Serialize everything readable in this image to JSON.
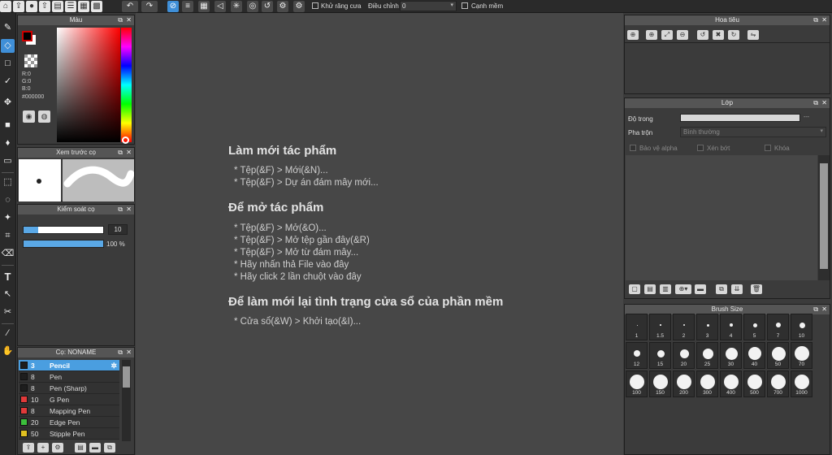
{
  "toolbar": {
    "antialias_label": "Khử răng cưa",
    "adjust_label": "Điều chỉnh",
    "adjust_value": "0",
    "soft_edge_label": "Cạnh mềm"
  },
  "color_panel": {
    "title": "Màu",
    "r": "R:0",
    "g": "G:0",
    "b": "B:0",
    "hex": "#000000",
    "main_color": "#000000",
    "accent": "#cc0000"
  },
  "preview_panel": {
    "title": "Xem trước cọ"
  },
  "brush_control": {
    "title": "Kiểm soát cọ",
    "size_value": "10",
    "opacity_value": "100 %"
  },
  "brush_panel": {
    "title": "Cọ: NONAME",
    "brushes": [
      {
        "size": "3",
        "name": "Pencil",
        "color": "#1e1e1e"
      },
      {
        "size": "8",
        "name": "Pen",
        "color": "#1e1e1e"
      },
      {
        "size": "8",
        "name": "Pen (Sharp)",
        "color": "#1e1e1e"
      },
      {
        "size": "10",
        "name": "G Pen",
        "color": "#e03a3a"
      },
      {
        "size": "8",
        "name": "Mapping Pen",
        "color": "#e03a3a"
      },
      {
        "size": "20",
        "name": "Edge Pen",
        "color": "#3cc03c"
      },
      {
        "size": "50",
        "name": "Stipple Pen",
        "color": "#e0c020"
      }
    ]
  },
  "canvas": {
    "new_heading": "Làm mới tác phẩm",
    "new_items": [
      "* Tệp(&F) > Mới(&N)...",
      "* Tệp(&F) > Dự án đám mây mới..."
    ],
    "open_heading": "Để mở tác phẩm",
    "open_items": [
      "* Tệp(&F) > Mở(&O)...",
      "* Tệp(&F) > Mở tệp gần đây(&R)",
      "* Tệp(&F) > Mở từ đám mây...",
      "* Hãy nhấn thả File vào đây",
      "* Hãy click 2 lần chuột vào đây"
    ],
    "reset_heading": "Để làm mới lại tình trạng cửa sổ của phần mềm",
    "reset_items": [
      "* Cửa sổ(&W) > Khởi tạo(&I)..."
    ]
  },
  "navigator_panel": {
    "title": "Hoa tiêu"
  },
  "layer_panel": {
    "title": "Lớp",
    "opacity_label": "Độ trong",
    "blend_label": "Pha trộn",
    "blend_value": "Bình thường",
    "protect_alpha": "Bảo vệ alpha",
    "clipping": "Xén bớt",
    "lock": "Khóa",
    "opacity_dash": "---"
  },
  "brush_size_panel": {
    "title": "Brush Size",
    "sizes": [
      "1",
      "1.5",
      "2",
      "3",
      "4",
      "5",
      "7",
      "10",
      "12",
      "15",
      "20",
      "25",
      "30",
      "40",
      "50",
      "70",
      "100",
      "150",
      "200",
      "300",
      "400",
      "500",
      "700",
      "1000"
    ]
  }
}
